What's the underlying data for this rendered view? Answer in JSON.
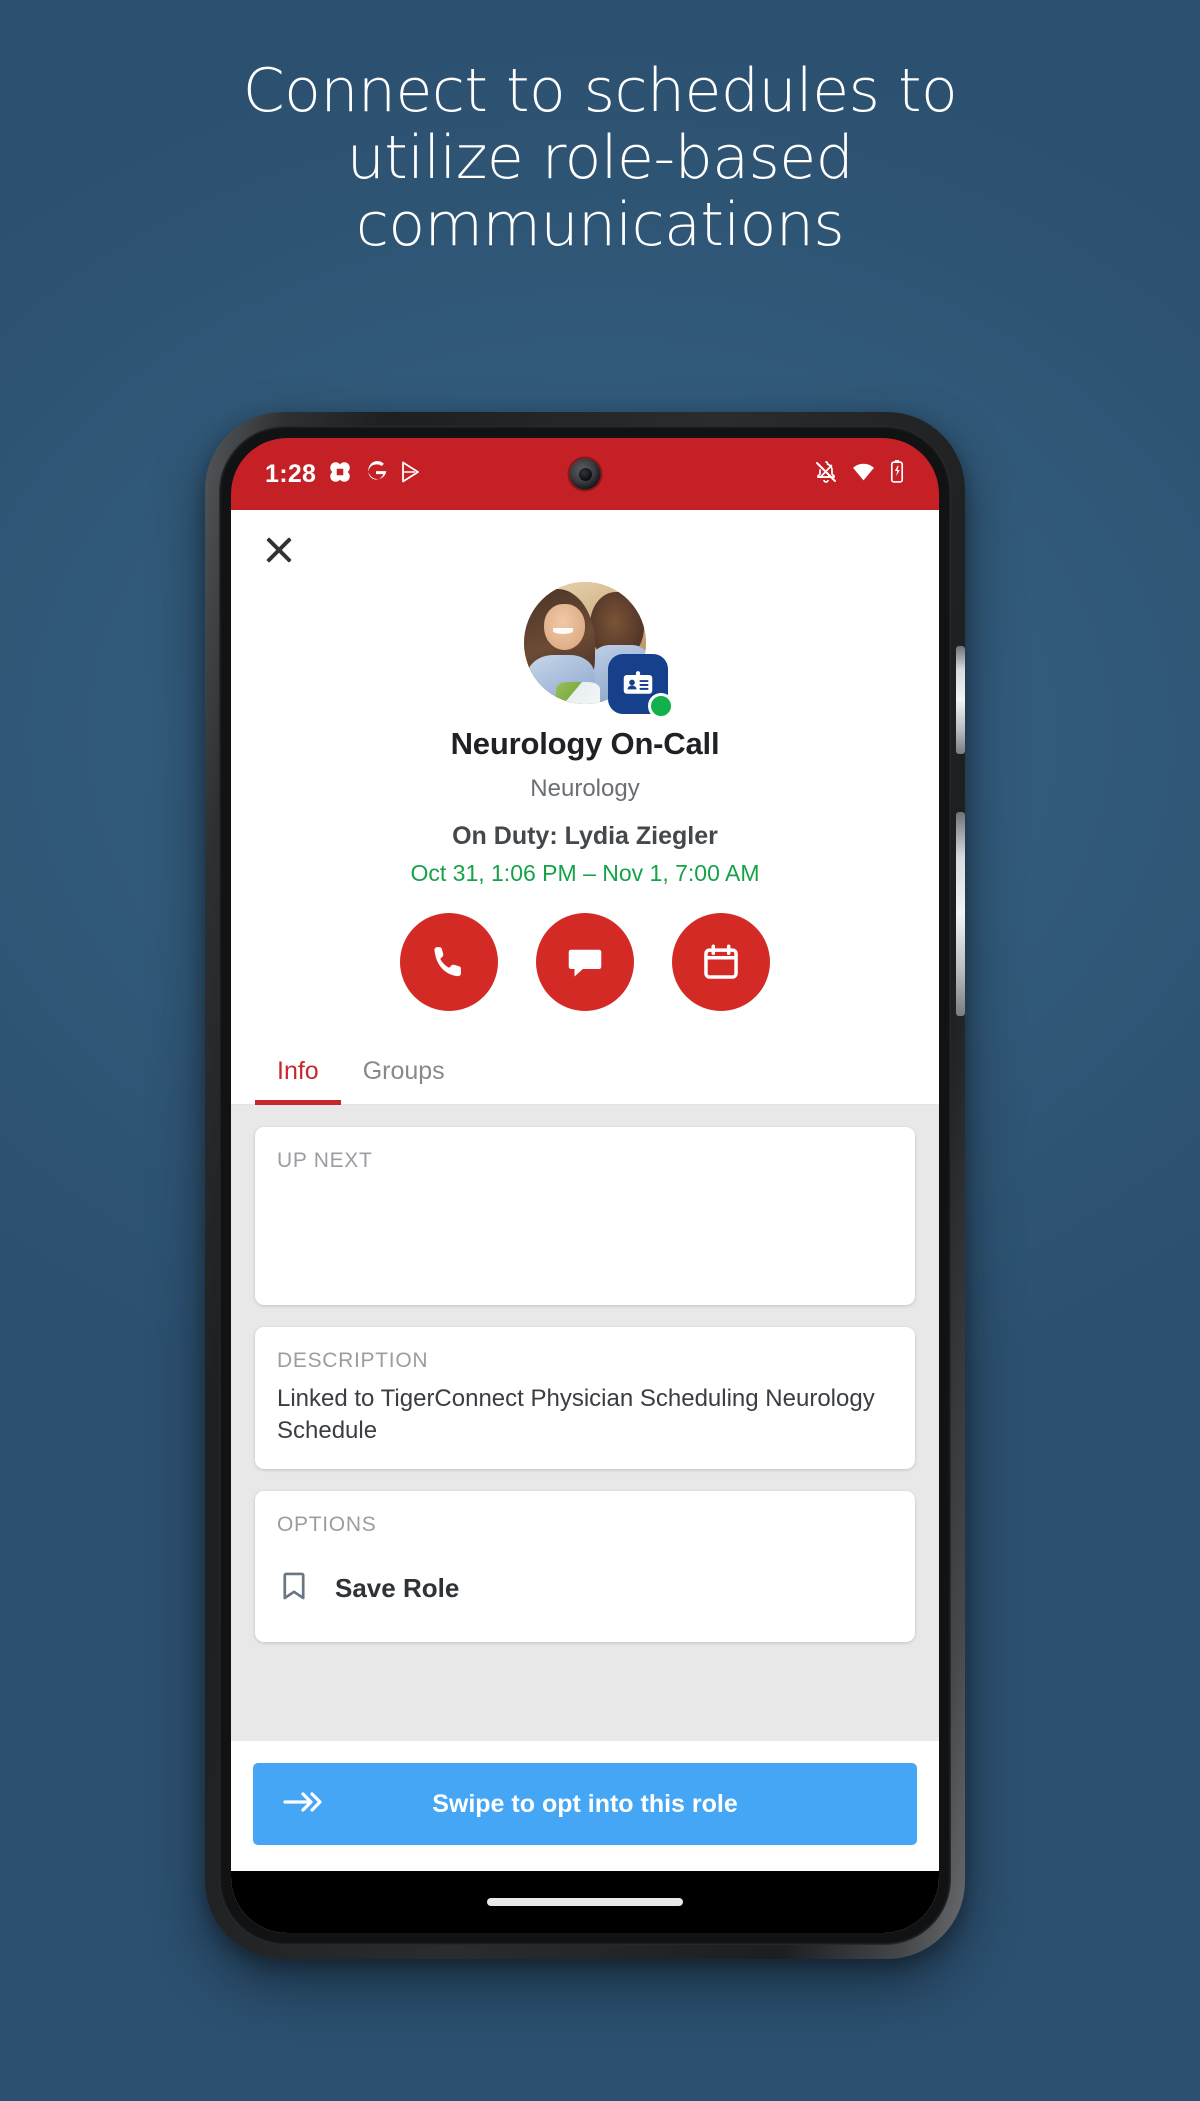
{
  "headline": {
    "line1": "Connect to schedules to",
    "line2": "utilize role-based",
    "line3": "communications"
  },
  "status_bar": {
    "time": "1:28",
    "left_icons": [
      "tigerconnect-icon",
      "google-icon",
      "play-store-icon"
    ],
    "right_icons": [
      "notifications-off-icon",
      "wifi-icon",
      "battery-charging-icon"
    ],
    "background_color": "#c42026"
  },
  "topbar": {
    "close_label": "close-icon"
  },
  "profile": {
    "avatar_alt": "Profile photo",
    "badge": "role-badge-icon",
    "presence": "online",
    "presence_color": "#12b14b",
    "name": "Neurology On-Call",
    "department": "Neurology",
    "on_duty": "On Duty: Lydia Ziegler",
    "shift_time": "Oct 31, 1:06 PM – Nov 1, 7:00 AM",
    "shift_time_color": "#17a24a"
  },
  "actions": [
    {
      "name": "call-button",
      "icon": "phone-icon"
    },
    {
      "name": "message-button",
      "icon": "chat-bubble-icon"
    },
    {
      "name": "schedule-button",
      "icon": "calendar-icon"
    }
  ],
  "tabs": [
    {
      "label": "Info",
      "active": true
    },
    {
      "label": "Groups",
      "active": false
    }
  ],
  "cards": {
    "up_next": {
      "label": "UP NEXT",
      "body": ""
    },
    "description": {
      "label": "DESCRIPTION",
      "body": "Linked to TigerConnect Physician Scheduling Neurology Schedule"
    },
    "options": {
      "label": "OPTIONS",
      "items": [
        {
          "label": "Save Role",
          "icon": "bookmark-icon"
        }
      ]
    }
  },
  "swipe": {
    "label": "Swipe to opt into this role",
    "icon": "double-chevron-right-icon",
    "color": "#45a6f5"
  },
  "theme": {
    "background": "#335b80",
    "accent_red": "#d42a26",
    "tab_active": "#c7282c",
    "badge_blue": "#16408c"
  }
}
